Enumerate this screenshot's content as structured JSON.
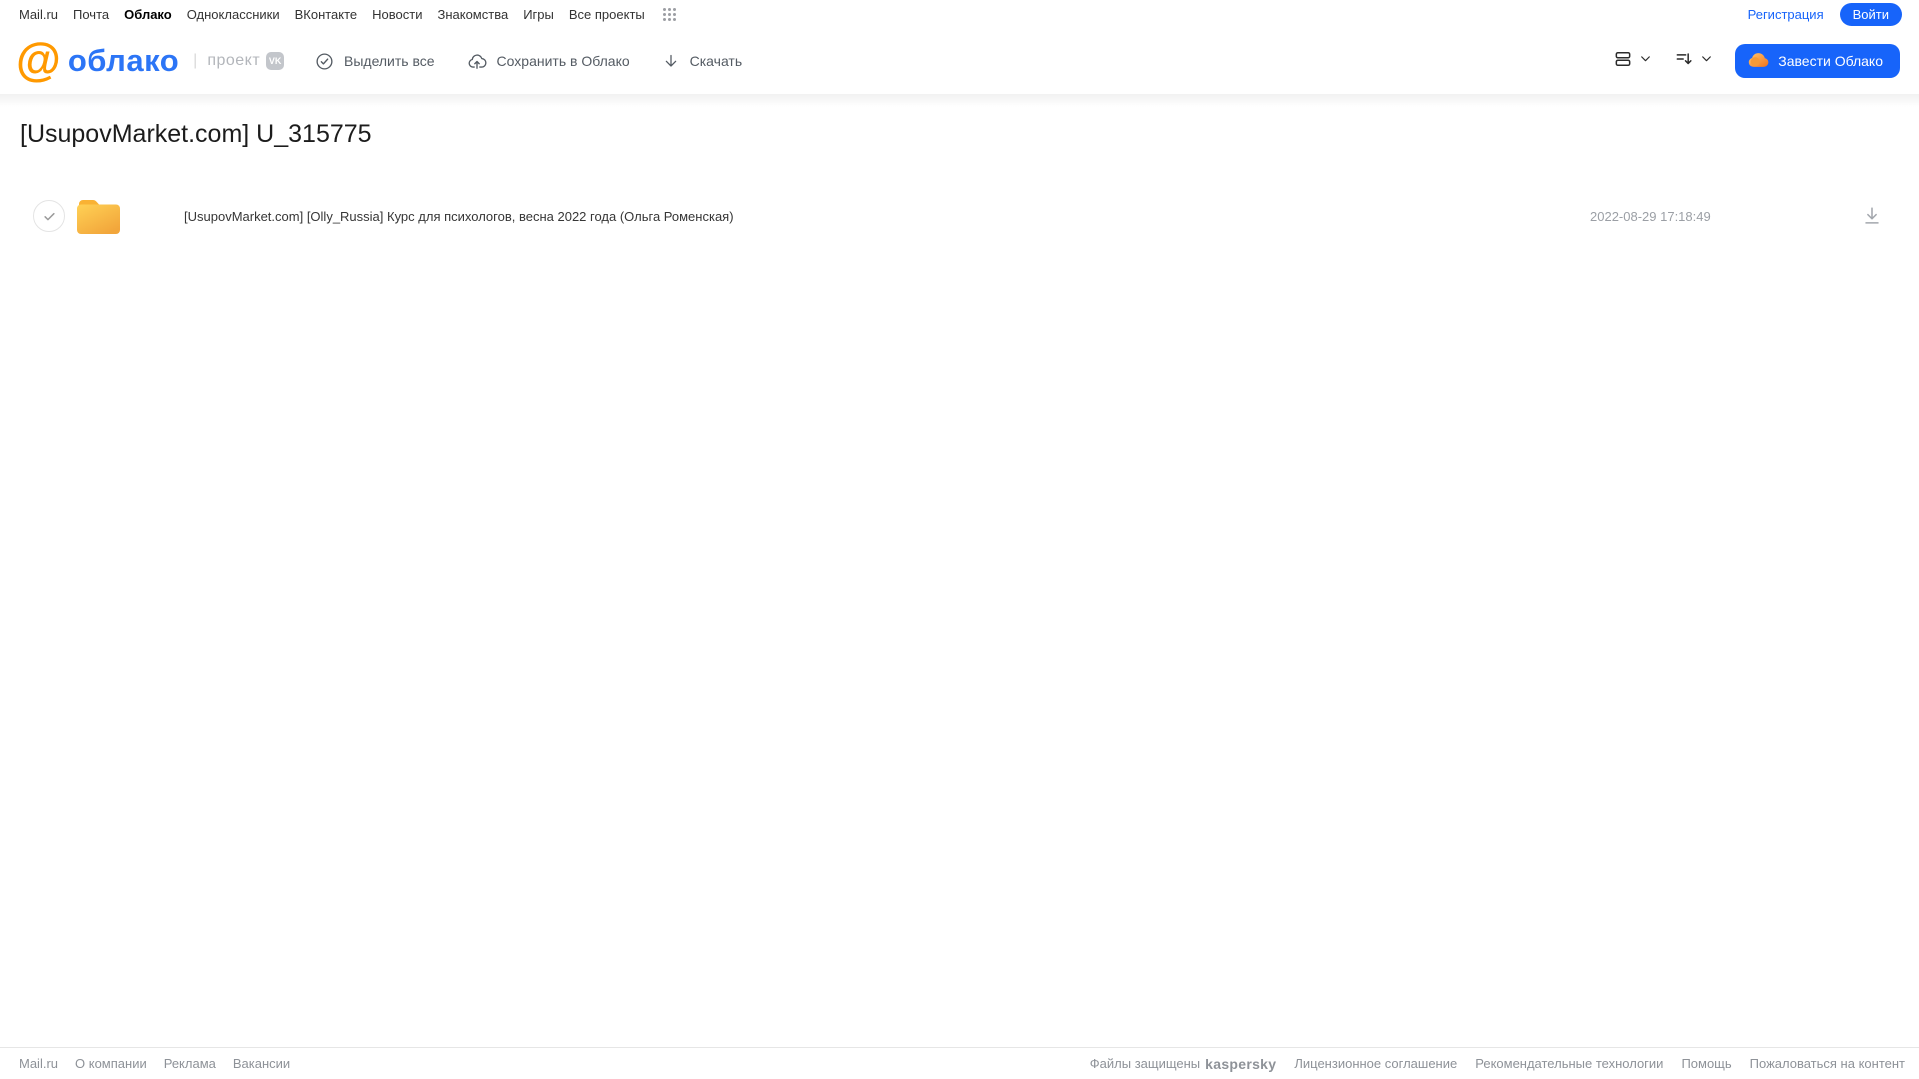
{
  "topnav": {
    "items": [
      "Mail.ru",
      "Почта",
      "Облако",
      "Одноклассники",
      "ВКонтакте",
      "Новости",
      "Знакомства",
      "Игры",
      "Все проекты"
    ],
    "active_item": "Облако",
    "registration_label": "Регистрация",
    "login_label": "Войти"
  },
  "header": {
    "logo_at": "@",
    "logo_text": "облако",
    "project_label": "проект",
    "vk_badge": "VK",
    "toolbar": {
      "select_all_label": "Выделить все",
      "save_to_cloud_label": "Сохранить в Облако",
      "download_label": "Скачать"
    },
    "cta_label": "Завести Облако"
  },
  "page": {
    "title": "[UsupovMarket.com] U_315775"
  },
  "files": [
    {
      "type": "folder",
      "name": "[UsupovMarket.com] [Olly_Russia] Курс для психологов, весна 2022 года (Ольга Роменская)",
      "date": "2022-08-29 17:18:49"
    }
  ],
  "footer": {
    "left_links": [
      "Mail.ru",
      "О компании",
      "Реклама",
      "Вакансии"
    ],
    "protected_label": "Файлы защищены",
    "kaspersky_label": "kaspersky",
    "right_links": [
      "Лицензионное соглашение",
      "Рекомендательные технологии",
      "Помощь",
      "Пожаловаться на контент"
    ]
  },
  "colors": {
    "accent_blue": "#1764fa",
    "logo_orange": "#ff9900",
    "logo_blue": "#2c75f6",
    "folder_yellow_top": "#ffce4d",
    "folder_yellow_bottom": "#f3a73c",
    "kaspersky_green": "#00a88e"
  }
}
